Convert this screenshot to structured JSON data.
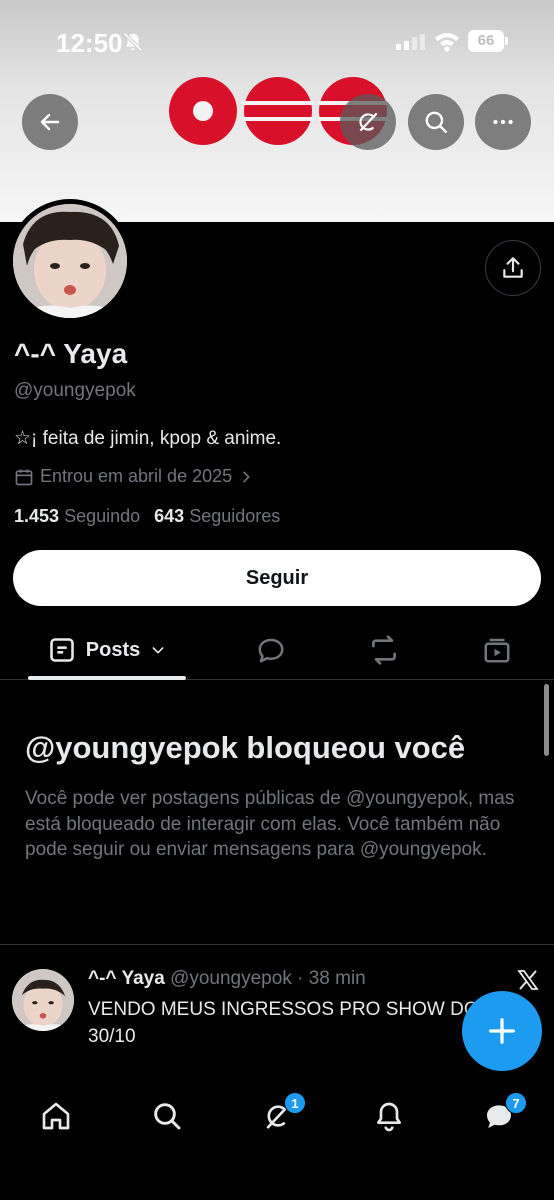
{
  "status_bar": {
    "time": "12:50",
    "battery": "66"
  },
  "icons": {
    "back": "arrow-left-icon",
    "grok": "grok-icon",
    "search": "search-icon",
    "more": "more-icon",
    "share": "share-icon",
    "calendar": "calendar-icon",
    "chevron": "chevron-right-icon",
    "posts_tab": "posts-icon",
    "replies_tab": "reply-icon",
    "reposts_tab": "repost-icon",
    "media_tab": "media-icon",
    "compose": "plus-icon",
    "home": "home-icon",
    "explore": "search-icon",
    "grok_nav": "grok-icon",
    "notifications": "bell-icon",
    "messages": "messages-icon",
    "x_logo": "x-logo-icon"
  },
  "profile": {
    "display_name": "^-^ Yaya",
    "handle": "@youngyepok",
    "bio": "☆¡ feita de jimin, kpop & anime.",
    "joined": "Entrou em abril de 2025",
    "following_count": "1.453",
    "following_label": "Seguindo",
    "followers_count": "643",
    "followers_label": "Seguidores",
    "follow_button": "Seguir"
  },
  "tabs": {
    "posts_label": "Posts"
  },
  "blocked": {
    "title": "@youngyepok bloqueou você",
    "message": "Você pode ver postagens públicas de @youngyepok, mas está bloqueado de interagir com elas. Você também não pode seguir ou enviar mensagens para @youngyepok."
  },
  "tweet": {
    "name": "^-^ Yaya",
    "handle_time": "@youngyepok · 38 min",
    "text": "VENDO MEUS INGRESSOS PRO SHOW DO DIA 30/10"
  },
  "bottom_nav": {
    "grok_badge": "1",
    "messages_badge": "7"
  },
  "colors": {
    "accent": "#1d9bf0",
    "banner_red": "#d8102a",
    "muted": "#71767b"
  }
}
